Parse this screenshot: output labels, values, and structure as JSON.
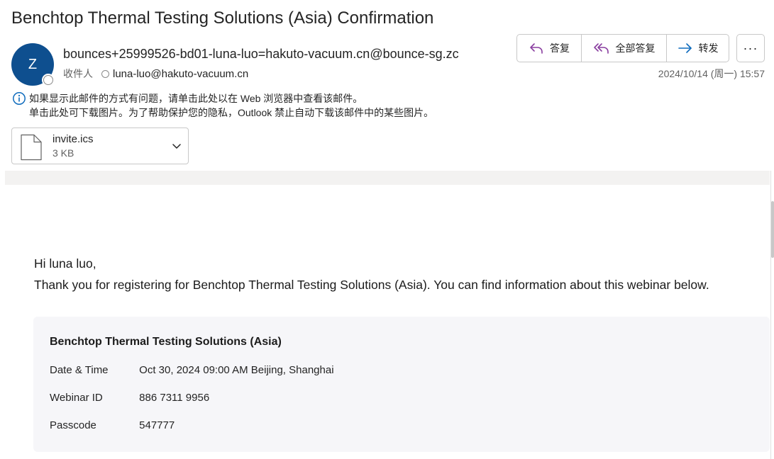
{
  "email": {
    "subject": "Benchtop Thermal Testing Solutions (Asia) Confirmation",
    "avatar_initial": "Z",
    "sender": "bounces+25999526-bd01-luna-luo=hakuto-vacuum.cn@bounce-sg.zc",
    "to_label": "收件人",
    "to_address": "luna-luo@hakuto-vacuum.cn",
    "date": "2024/10/14 (周一) 15:57"
  },
  "actions": {
    "reply_label": "答复",
    "reply_all_label": "全部答复",
    "forward_label": "转发",
    "more_label": "···"
  },
  "info": {
    "line1": "如果显示此邮件的方式有问题，请单击此处以在 Web 浏览器中查看该邮件。",
    "line2": "单击此处可下载图片。为了帮助保护您的隐私，Outlook 禁止自动下载该邮件中的某些图片。"
  },
  "attachment": {
    "name": "invite.ics",
    "size": "3 KB"
  },
  "body": {
    "greeting": "Hi luna luo,",
    "thanks": "Thank you for registering for Benchtop Thermal Testing Solutions (Asia). You can find information about this webinar below."
  },
  "webinar": {
    "title": "Benchtop Thermal Testing Solutions (Asia)",
    "rows": [
      {
        "label": "Date & Time",
        "value": "Oct 30, 2024 09:00 AM Beijing, Shanghai"
      },
      {
        "label": "Webinar ID",
        "value": "886 7311 9956"
      },
      {
        "label": "Passcode",
        "value": "547777"
      }
    ]
  },
  "colors": {
    "avatar_bg": "#0e4f8f",
    "accent_purple": "#8a3fa0",
    "accent_blue": "#0f6cbd"
  },
  "icons": {
    "reply": "reply-arrow-icon",
    "reply_all": "reply-all-arrow-icon",
    "forward": "forward-arrow-icon",
    "info": "info-icon",
    "file": "file-icon",
    "chevron": "chevron-down-icon"
  }
}
